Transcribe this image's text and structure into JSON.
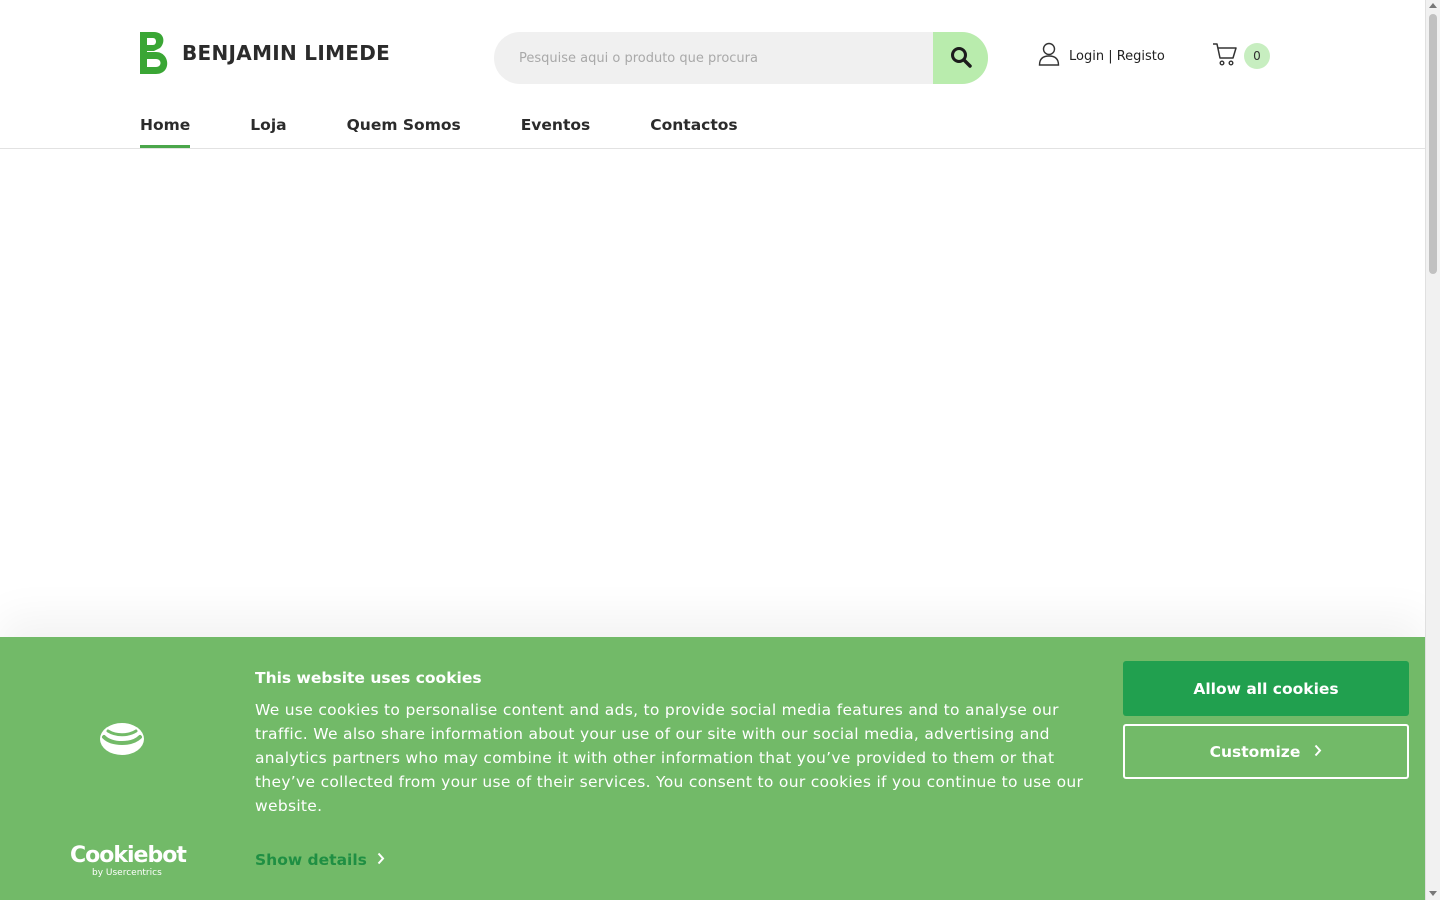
{
  "header": {
    "brand": "BENJAMIN LIMEDE",
    "search": {
      "placeholder": "Pesquise aqui o produto que procura"
    },
    "account": {
      "label": "Login | Registo"
    },
    "cart": {
      "count": "0"
    }
  },
  "nav": {
    "items": [
      {
        "label": "Home"
      },
      {
        "label": "Loja"
      },
      {
        "label": "Quem Somos"
      },
      {
        "label": "Eventos"
      },
      {
        "label": "Contactos"
      }
    ],
    "active": "Home"
  },
  "cookie_banner": {
    "title": "This website uses cookies",
    "body": "We use cookies to personalise content and ads, to provide social media features and to analyse our traffic. We also share information about your use of our site with our social media, advertising and analytics partners who may combine it with other information that you’ve provided to them or that they’ve collected from your use of their services. You consent to our cookies if you continue to use our website.",
    "show_details": "Show details",
    "allow_all": "Allow all cookies",
    "customize": "Customize",
    "brand_name": "Cookiebot",
    "brand_by": "by Usercentrics"
  },
  "colors": {
    "brand_green": "#3aa635",
    "search_button": "#b9ecad",
    "cookie_background": "#72ba68",
    "allow_button": "#21a04f",
    "show_details_link": "#1f8f43"
  },
  "icons": [
    "logo-b-icon",
    "search-icon",
    "user-icon",
    "cart-icon",
    "cookie-icon",
    "chevron-right-icon"
  ]
}
